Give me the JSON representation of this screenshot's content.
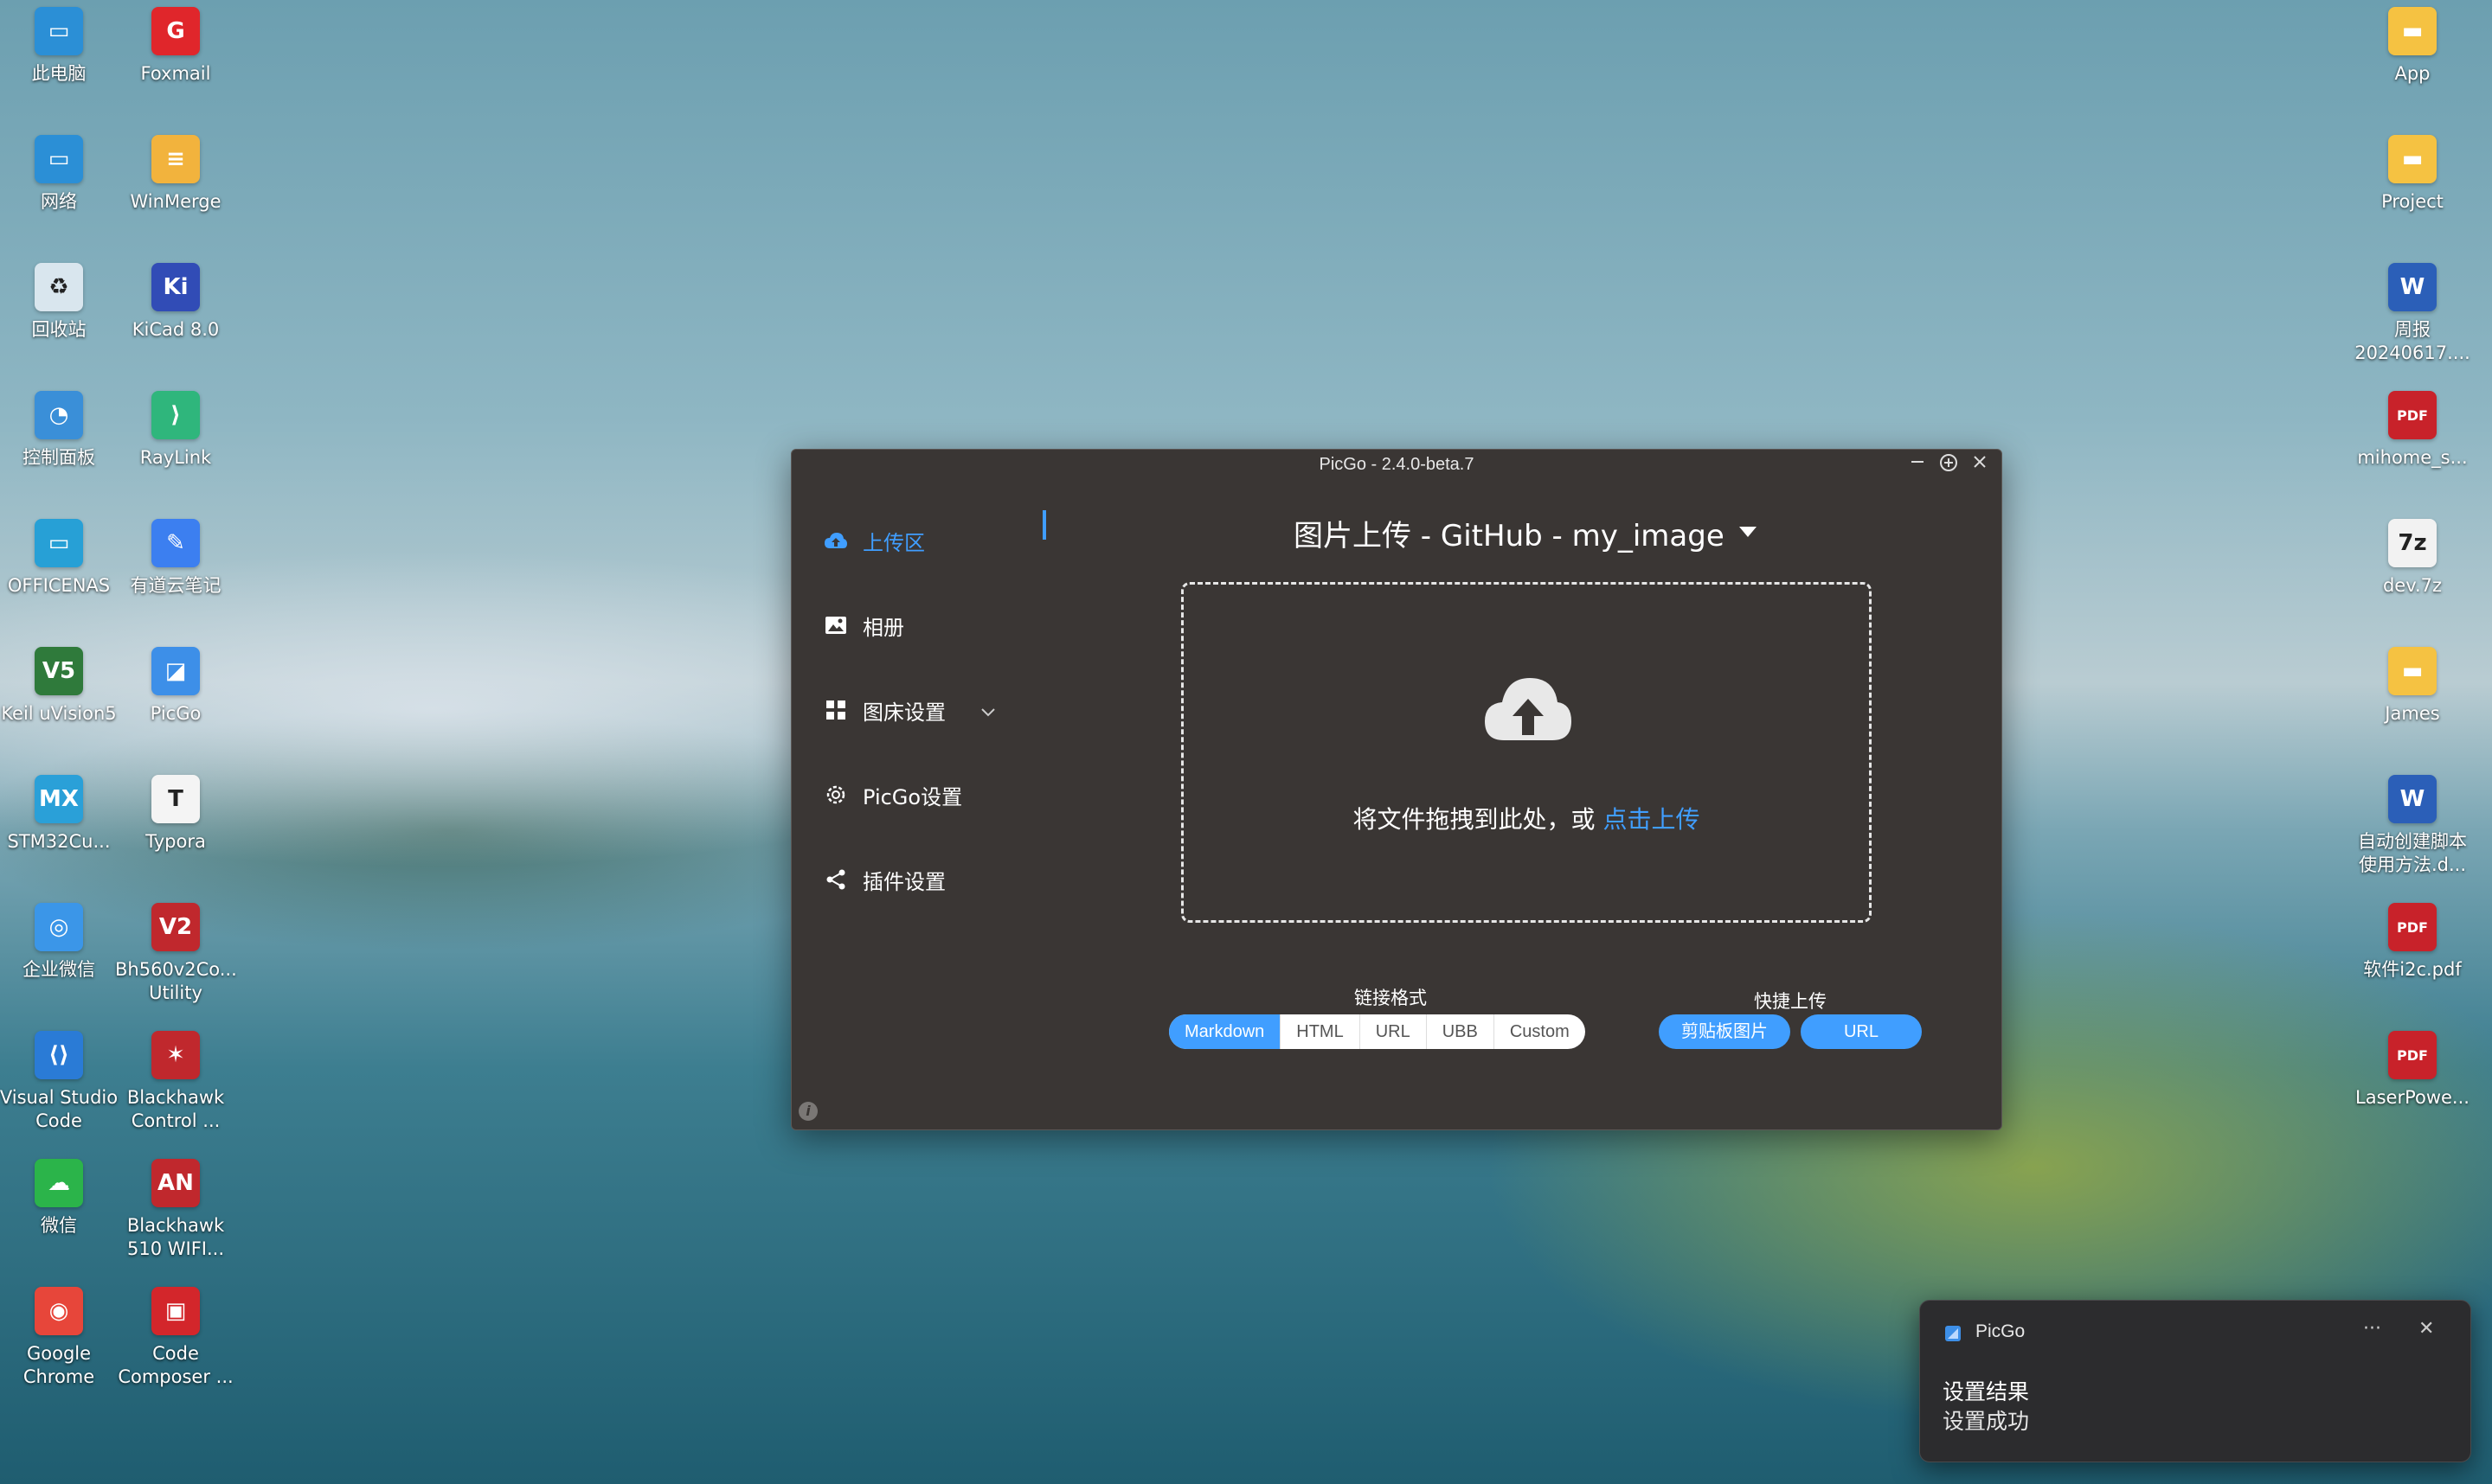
{
  "desktop": {
    "left_icons": [
      {
        "label": "此电脑",
        "icon": "computer-icon",
        "color": "#2b8fd6",
        "glyph": "▭"
      },
      {
        "label": "Foxmail",
        "icon": "foxmail-icon",
        "color": "#e0262b",
        "glyph": "G"
      },
      {
        "label": "网络",
        "icon": "network-icon",
        "color": "#2b8fd6",
        "glyph": "▭"
      },
      {
        "label": "WinMerge",
        "icon": "winmerge-icon",
        "color": "#f2b33d",
        "glyph": "≡"
      },
      {
        "label": "回收站",
        "icon": "recycle-bin-icon",
        "color": "#d9e6ee",
        "glyph": "♻"
      },
      {
        "label": "KiCad 8.0",
        "icon": "kicad-icon",
        "color": "#314cb6",
        "glyph": "Ki"
      },
      {
        "label": "控制面板",
        "icon": "control-panel-icon",
        "color": "#3a8fd8",
        "glyph": "◔"
      },
      {
        "label": "RayLink",
        "icon": "raylink-icon",
        "color": "#2fb67c",
        "glyph": "⟩"
      },
      {
        "label": "OFFICENAS",
        "icon": "officenas-icon",
        "color": "#27a0d6",
        "glyph": "▭"
      },
      {
        "label": "有道云笔记",
        "icon": "youdao-note-icon",
        "color": "#3c7ff0",
        "glyph": "✎"
      },
      {
        "label": "Keil uVision5",
        "icon": "keil-icon",
        "color": "#2f7a3b",
        "glyph": "V5"
      },
      {
        "label": "PicGo",
        "icon": "picgo-icon",
        "color": "#3d8fe8",
        "glyph": "◪"
      },
      {
        "label": "STM32Cu...",
        "icon": "stm32cube-icon",
        "color": "#2aa0d8",
        "glyph": "MX"
      },
      {
        "label": "Typora",
        "icon": "typora-icon",
        "color": "#f4f4f4",
        "glyph": "T"
      },
      {
        "label": "企业微信",
        "icon": "wecom-icon",
        "color": "#3b96e8",
        "glyph": "◎"
      },
      {
        "label": "Bh560v2Co... Utility",
        "icon": "blackhawk-utility-icon",
        "color": "#c0282d",
        "glyph": "V2"
      },
      {
        "label": "Visual Studio Code",
        "icon": "vscode-icon",
        "color": "#2a7bd6",
        "glyph": "⟨⟩"
      },
      {
        "label": "Blackhawk Control ...",
        "icon": "blackhawk-control-icon",
        "color": "#c0282d",
        "glyph": "✶"
      },
      {
        "label": "微信",
        "icon": "wechat-icon",
        "color": "#2bb44a",
        "glyph": "☁"
      },
      {
        "label": "Blackhawk 510 WIFI...",
        "icon": "blackhawk-wifi-icon",
        "color": "#c0282d",
        "glyph": "AN"
      },
      {
        "label": "Google Chrome",
        "icon": "chrome-icon",
        "color": "#e7463a",
        "glyph": "◉"
      },
      {
        "label": "Code Composer ...",
        "icon": "code-composer-icon",
        "color": "#d3262b",
        "glyph": "▣"
      }
    ],
    "right_icons": [
      {
        "label": "App",
        "icon": "folder-icon",
        "color": "#f5c242",
        "glyph": "▬"
      },
      {
        "label": "Project",
        "icon": "folder-icon",
        "color": "#f5c242",
        "glyph": "▬"
      },
      {
        "label": "周报 20240617....",
        "icon": "word-doc-icon",
        "color": "#2b5fb8",
        "glyph": "W"
      },
      {
        "label": "mihome_s...",
        "icon": "pdf-icon",
        "color": "#c8222a",
        "glyph": "PDF"
      },
      {
        "label": "dev.7z",
        "icon": "7z-archive-icon",
        "color": "#f2f2f2",
        "glyph": "7z"
      },
      {
        "label": "James",
        "icon": "folder-icon",
        "color": "#f5c242",
        "glyph": "▬"
      },
      {
        "label": "自动创建脚本 使用方法.d...",
        "icon": "word-doc-icon",
        "color": "#2b5fb8",
        "glyph": "W"
      },
      {
        "label": "软件i2c.pdf",
        "icon": "pdf-icon",
        "color": "#c8222a",
        "glyph": "PDF"
      },
      {
        "label": "LaserPowe...",
        "icon": "pdf-icon",
        "color": "#c8222a",
        "glyph": "PDF"
      }
    ]
  },
  "picgo": {
    "window_title": "PicGo - 2.4.0-beta.7",
    "sidebar": [
      {
        "label": "上传区",
        "icon": "cloud-upload-icon",
        "active": true
      },
      {
        "label": "相册",
        "icon": "image-icon",
        "active": false
      },
      {
        "label": "图床设置",
        "icon": "grid-icon",
        "active": false
      },
      {
        "label": "PicGo设置",
        "icon": "gear-icon",
        "active": false
      },
      {
        "label": "插件设置",
        "icon": "share-icon",
        "active": false
      }
    ],
    "main_title": "图片上传 - GitHub - my_image",
    "drop_text": "将文件拖拽到此处，或 ",
    "drop_link": "点击上传",
    "link_format_label": "链接格式",
    "link_formats": [
      "Markdown",
      "HTML",
      "URL",
      "UBB",
      "Custom"
    ],
    "selected_format": "Markdown",
    "quick_upload_label": "快捷上传",
    "quick_upload_buttons": [
      "剪贴板图片",
      "URL"
    ],
    "accent_color": "#409eff"
  },
  "toast": {
    "app_name": "PicGo",
    "title": "设置结果",
    "body": "设置成功",
    "more_label": "···",
    "close_label": "✕"
  }
}
